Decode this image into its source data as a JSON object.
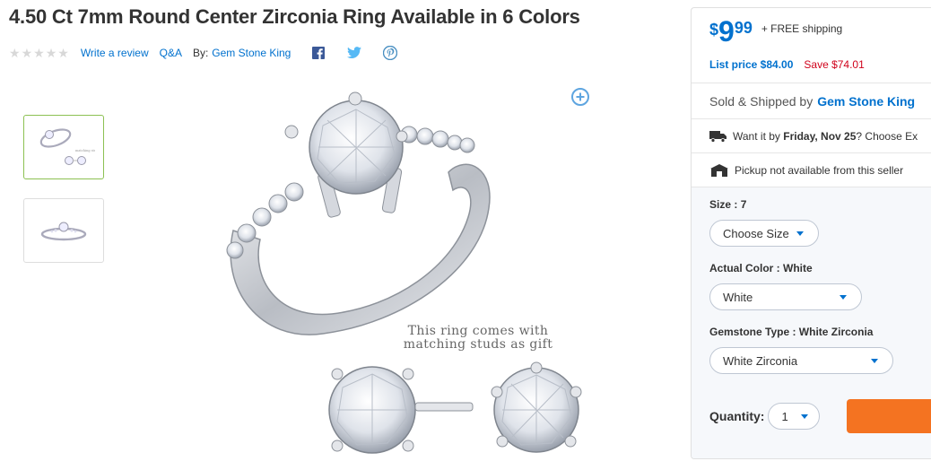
{
  "product": {
    "title": "4.50 Ct 7mm Round Center Zirconia Ring Available in 6 Colors",
    "rating_stars": 5,
    "write_review": "Write a review",
    "qa": "Q&A",
    "by_label": "By:",
    "seller": "Gem Stone King",
    "gift_caption_line1": "This ring comes with",
    "gift_caption_line2": "matching studs as gift"
  },
  "social": {
    "icons": [
      "facebook-icon",
      "twitter-icon",
      "pinterest-icon"
    ]
  },
  "price": {
    "currency": "$",
    "whole": "9",
    "cents": "99",
    "shipping": "+ FREE shipping",
    "list_price": "List price $84.00",
    "save": "Save $74.01"
  },
  "sold": {
    "label": "Sold & Shipped by",
    "seller": "Gem Stone King"
  },
  "delivery": {
    "prefix": "Want it by",
    "date": "Friday, Nov 25",
    "suffix": "? Choose Ex"
  },
  "pickup": {
    "text": "Pickup not available from this seller"
  },
  "options": {
    "size_label": "Size : ",
    "size_value": "7",
    "size_select": "Choose Size",
    "color_label": "Actual Color : ",
    "color_value": "White",
    "color_select": "White",
    "gem_label": "Gemstone Type : ",
    "gem_value": "White Zirconia",
    "gem_select": "White Zirconia",
    "quantity_label": "Quantity:",
    "quantity_value": "1"
  },
  "colors": {
    "accent": "#0071ce",
    "save_red": "#d0021b",
    "cart_orange": "#f47321",
    "thumb_active": "#8cc152"
  }
}
